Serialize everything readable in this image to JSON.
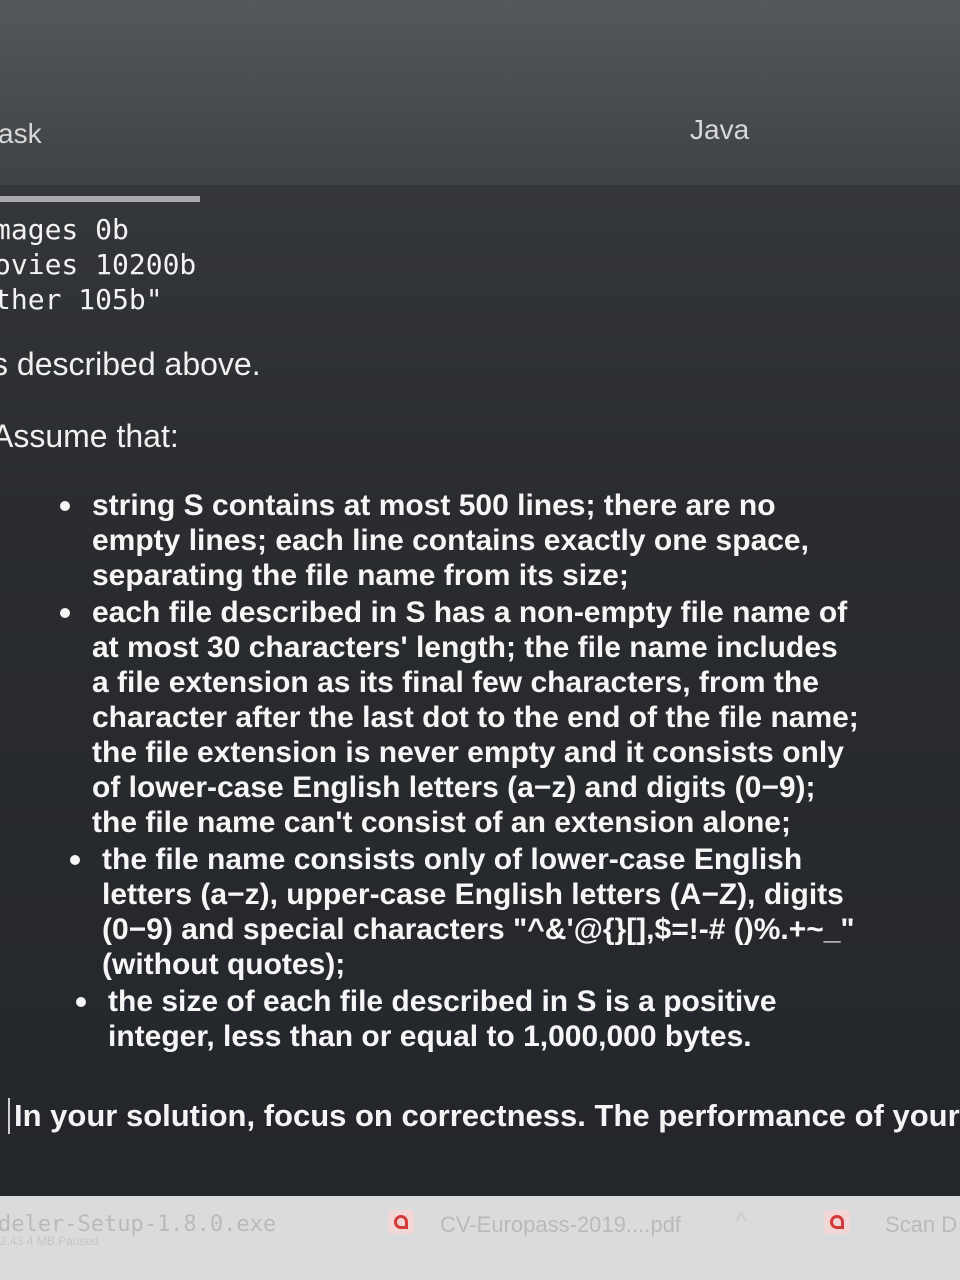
{
  "header": {
    "task_tab": "ask",
    "language_tab": "Java"
  },
  "code": {
    "lines": [
      "mages 0b",
      "ovies 10200b",
      "ther 105b\""
    ]
  },
  "text": {
    "described": "s described above.",
    "assume": "Assume that:",
    "bullets": [
      "string S contains at most 500 lines; there are no empty lines; each line contains exactly one space, separating the file name from its size;",
      "each file described in S has a non-empty file name of at most 30 characters' length; the file name includes a file extension as its final few characters, from the character after the last dot to the end of the file name; the file extension is never empty and it consists only of lower-case English letters (a−z) and digits (0−9); the file name can't consist of an extension alone;",
      "the file name consists only of lower-case English letters (a−z), upper-case English letters (A−Z), digits (0−9) and special characters \"^&'@{}[],$=!-# ()%.+~_\" (without quotes);",
      "the size of each file described in S is a positive integer, less than or equal to 1,000,000 bytes."
    ],
    "solution_note": "In your solution, focus on correctness. The performance of your"
  },
  "downloads": {
    "item1": "deler-Setup-1.8.0.exe",
    "item1_sub": "2,43 4 MB Paused",
    "item2": "CV-Europass-2019....pdf",
    "item3": "Scan D"
  }
}
